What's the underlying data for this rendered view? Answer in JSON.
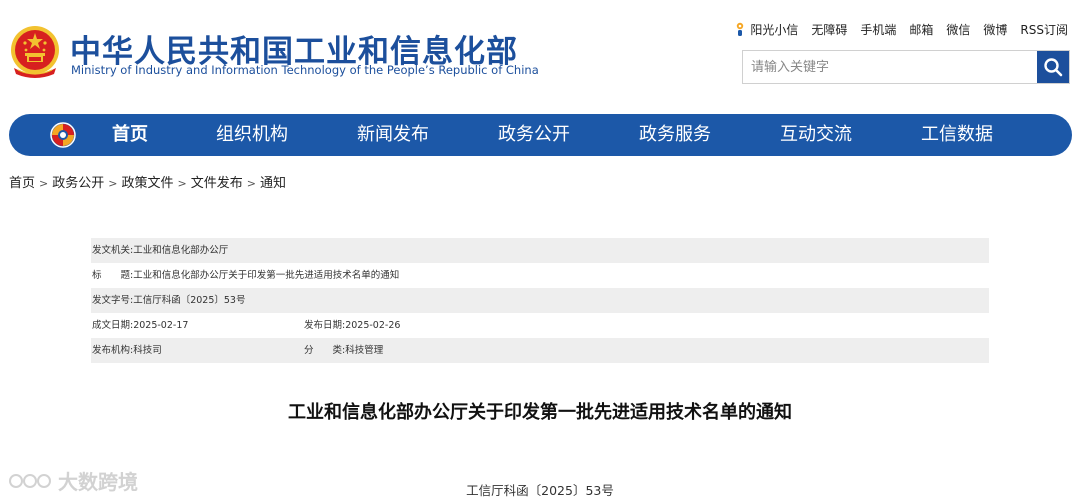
{
  "header": {
    "title_cn": "中华人民共和国工业和信息化部",
    "title_en": "Ministry of Industry and Information Technology of the People’s Republic of China",
    "emblem_icon": "national-emblem-icon"
  },
  "top_links": [
    {
      "label": "阳光小信",
      "icon": "sunshine-icon"
    },
    {
      "label": "无障碍"
    },
    {
      "label": "手机端"
    },
    {
      "label": "邮箱"
    },
    {
      "label": "微信"
    },
    {
      "label": "微博"
    },
    {
      "label": "RSS订阅"
    }
  ],
  "search": {
    "placeholder": "请输入关键字",
    "value": "",
    "icon": "search-icon"
  },
  "nav": {
    "logo_icon": "miit-logo-icon",
    "items": [
      {
        "label": "首页",
        "active": true
      },
      {
        "label": "组织机构"
      },
      {
        "label": "新闻发布"
      },
      {
        "label": "政务公开"
      },
      {
        "label": "政务服务"
      },
      {
        "label": "互动交流"
      },
      {
        "label": "工信数据"
      }
    ]
  },
  "breadcrumb": [
    "首页",
    "政务公开",
    "政策文件",
    "文件发布",
    "通知"
  ],
  "meta": {
    "issuer_label": "发文机关:",
    "issuer": "工业和信息化部办公厅",
    "title_label": "标　　题:",
    "title": "工业和信息化部办公厅关于印发第一批先进适用技术名单的通知",
    "docno_label": "发文字号:",
    "docno": "工信厅科函〔2025〕53号",
    "written_label": "成文日期:",
    "written": "2025-02-17",
    "published_label": "发布日期:",
    "published": "2025-02-26",
    "org_label": "发布机构:",
    "org": "科技司",
    "category_label": "分　　类:",
    "category": "科技管理"
  },
  "article": {
    "title": "工业和信息化部办公厅关于印发第一批先进适用技术名单的通知",
    "doc_number": "工信厅科函〔2025〕53号"
  },
  "watermark": {
    "text": "大数跨境"
  },
  "colors": {
    "brand_blue": "#1c58a8",
    "title_blue": "#1c4f9c",
    "emblem_red": "#d7201f",
    "emblem_gold": "#f2c230"
  }
}
